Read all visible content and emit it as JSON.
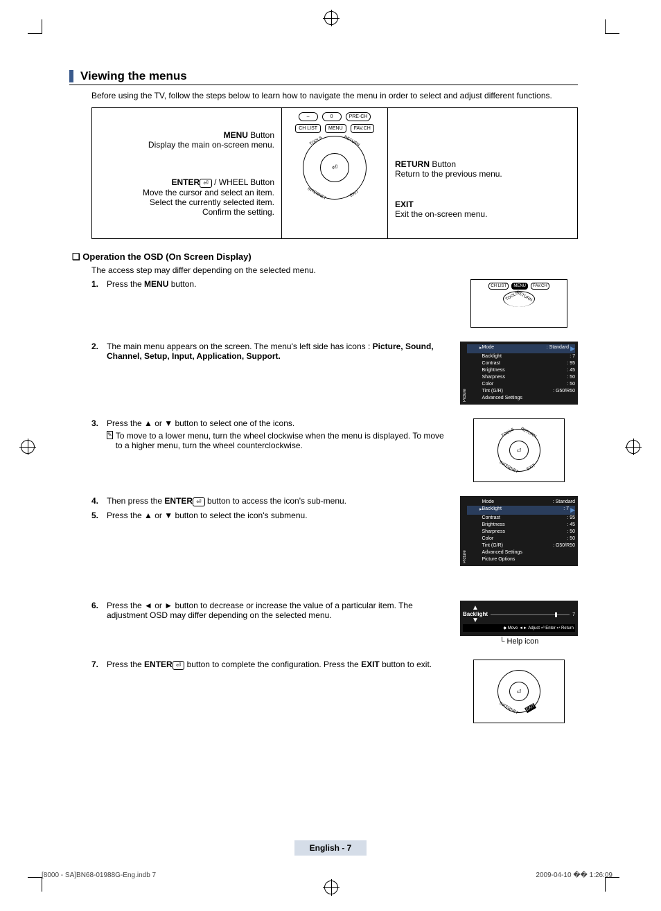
{
  "title": "Viewing the menus",
  "intro": "Before using the TV, follow the steps below to learn how to navigate the menu in order to select and adjust different functions.",
  "diagram": {
    "menu_btn_bold": "MENU",
    "menu_btn_rest": " Button",
    "menu_btn_desc": "Display the main on-screen menu.",
    "enter_btn_bold": "ENTER",
    "enter_btn_rest": " / WHEEL Button",
    "enter_btn_l1": "Move the cursor and select an item.",
    "enter_btn_l2": "Select the currently selected item.",
    "enter_btn_l3": "Confirm the setting.",
    "return_btn_bold": "RETURN",
    "return_btn_rest": " Button",
    "return_btn_desc": "Return to the previous menu.",
    "exit_btn_bold": "EXIT",
    "exit_btn_desc": "Exit the on-screen menu.",
    "remote": {
      "minus": "–",
      "zero": "0",
      "prech": "PRE-CH",
      "chlist": "CH LIST",
      "menu": "MENU",
      "favch": "FAV.CH",
      "tools": "TOOLS",
      "return": "RETURN",
      "internet": "INTERNET",
      "exit": "EXIT",
      "enter": "⏎"
    }
  },
  "subhead": "Operation the OSD (On Screen Display)",
  "sub_intro": "The access step may differ depending on the selected menu.",
  "steps": {
    "s1_num": "1.",
    "s1_a": "Press the ",
    "s1_b": "MENU",
    "s1_c": " button.",
    "s2_num": "2.",
    "s2_a": "The main menu appears on the screen. The menu's left side has icons : ",
    "s2_b": "Picture, Sound, Channel, Setup, Input, Application, Support.",
    "s3_num": "3.",
    "s3_a": "Press the ▲ or ▼ button to select one of the icons.",
    "s3_note": "To move to a lower menu, turn the wheel clockwise when the menu is displayed. To move to a higher menu, turn the wheel counterclockwise.",
    "s4_num": "4.",
    "s4_a": "Then press the ",
    "s4_b": "ENTER",
    "s4_c": " button to access the icon's sub-menu.",
    "s5_num": "5.",
    "s5_a": "Press the ▲ or ▼ button to select the icon's submenu.",
    "s6_num": "6.",
    "s6_a": "Press the ◄ or ► button to decrease or increase the value of a particular item. The adjustment OSD may differ depending on the selected menu.",
    "s7_num": "7.",
    "s7_a": "Press the ",
    "s7_b": "ENTER",
    "s7_c": " button to complete the configuration. Press the ",
    "s7_d": "EXIT",
    "s7_e": " button to exit."
  },
  "osd1": {
    "side": "Picture",
    "rows": [
      {
        "l": "Mode",
        "v": "Standard",
        "hi": true
      },
      {
        "l": "Backlight",
        "v": "7"
      },
      {
        "l": "Contrast",
        "v": "95"
      },
      {
        "l": "Brightness",
        "v": "45"
      },
      {
        "l": "Sharpness",
        "v": "50"
      },
      {
        "l": "Color",
        "v": "50"
      },
      {
        "l": "Tint (G/R)",
        "v": "G50/R50"
      },
      {
        "l": "Advanced Settings",
        "v": ""
      }
    ]
  },
  "osd2": {
    "side": "Picture",
    "rows": [
      {
        "l": "Mode",
        "v": "Standard"
      },
      {
        "l": "Backlight",
        "v": "7",
        "hi": true
      },
      {
        "l": "Contrast",
        "v": "95"
      },
      {
        "l": "Brightness",
        "v": "45"
      },
      {
        "l": "Sharpness",
        "v": "50"
      },
      {
        "l": "Color",
        "v": "50"
      },
      {
        "l": "Tint (G/R)",
        "v": "G50/R50"
      },
      {
        "l": "Advanced Settings",
        "v": ""
      },
      {
        "l": "Picture Options",
        "v": ""
      }
    ]
  },
  "slider": {
    "up": "▲",
    "label": "Backlight",
    "down": "▼",
    "value": "7",
    "help": "◆ Move   ◄► Adjust   ⏎ Enter   ↩ Return",
    "caption": "Help icon"
  },
  "footer": {
    "page": "English - 7",
    "docid": "[8000 - SA]BN68-01988G-Eng.indb   7",
    "stamp": "2009-04-10   �� 1:26:09"
  }
}
